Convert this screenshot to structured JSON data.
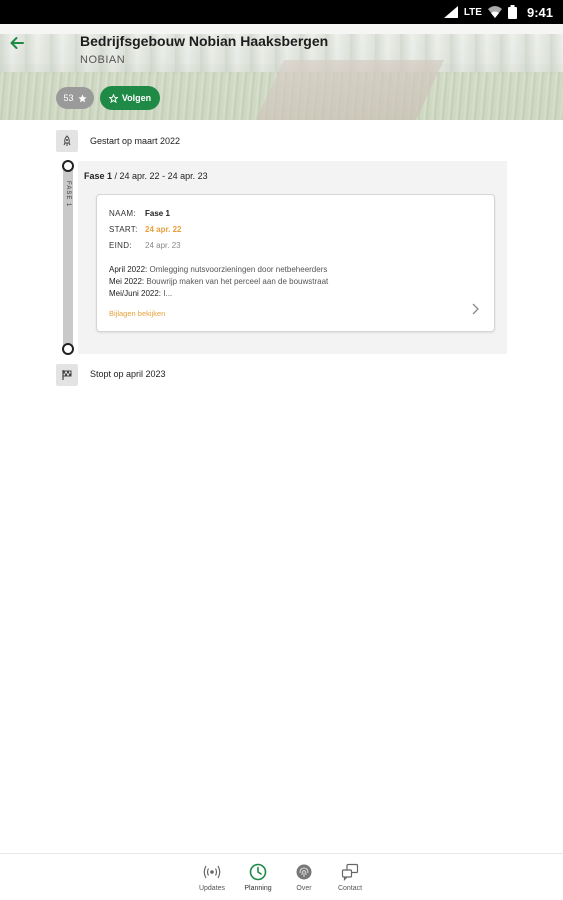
{
  "status_bar": {
    "network": "LTE",
    "time": "9:41"
  },
  "header": {
    "title": "Bedrijfsgebouw Nobian Haaksbergen",
    "subtitle": "NOBIAN",
    "followers_count": "53",
    "follow_label": "Volgen"
  },
  "timeline": {
    "start_label": "Gestart op maart 2022",
    "end_label": "Stopt op april 2023",
    "rail_label": "FASE 1",
    "phase": {
      "name": "Fase 1",
      "range": " / 24 apr. 22 - 24 apr. 23",
      "name_key": "NAAM:",
      "name_value": "Fase 1",
      "start_key": "START:",
      "start_value": "24 apr. 22",
      "end_key": "EIND:",
      "end_value": "24 apr. 23",
      "notes": [
        {
          "label": "April 2022:",
          "text": " Omlegging nutsvoorzieningen door netbeheerders"
        },
        {
          "label": "Mei 2022:",
          "text": " Bouwrijp maken van het perceel aan de bouwstraat"
        },
        {
          "label": "Mei/Juni 2022:",
          "text": " I..."
        }
      ],
      "details_link": "Bijlagen bekijken"
    }
  },
  "bottom_nav": {
    "items": [
      {
        "label": "Updates",
        "icon": "broadcast-icon"
      },
      {
        "label": "Planning",
        "icon": "clock-icon"
      },
      {
        "label": "Over",
        "icon": "fingerprint-icon"
      },
      {
        "label": "Contact",
        "icon": "contact-icon"
      }
    ],
    "active": "Planning"
  },
  "colors": {
    "brand_green": "#1f8a46",
    "accent_orange": "#e8a13a",
    "badge_gray": "#9a9a9a"
  }
}
